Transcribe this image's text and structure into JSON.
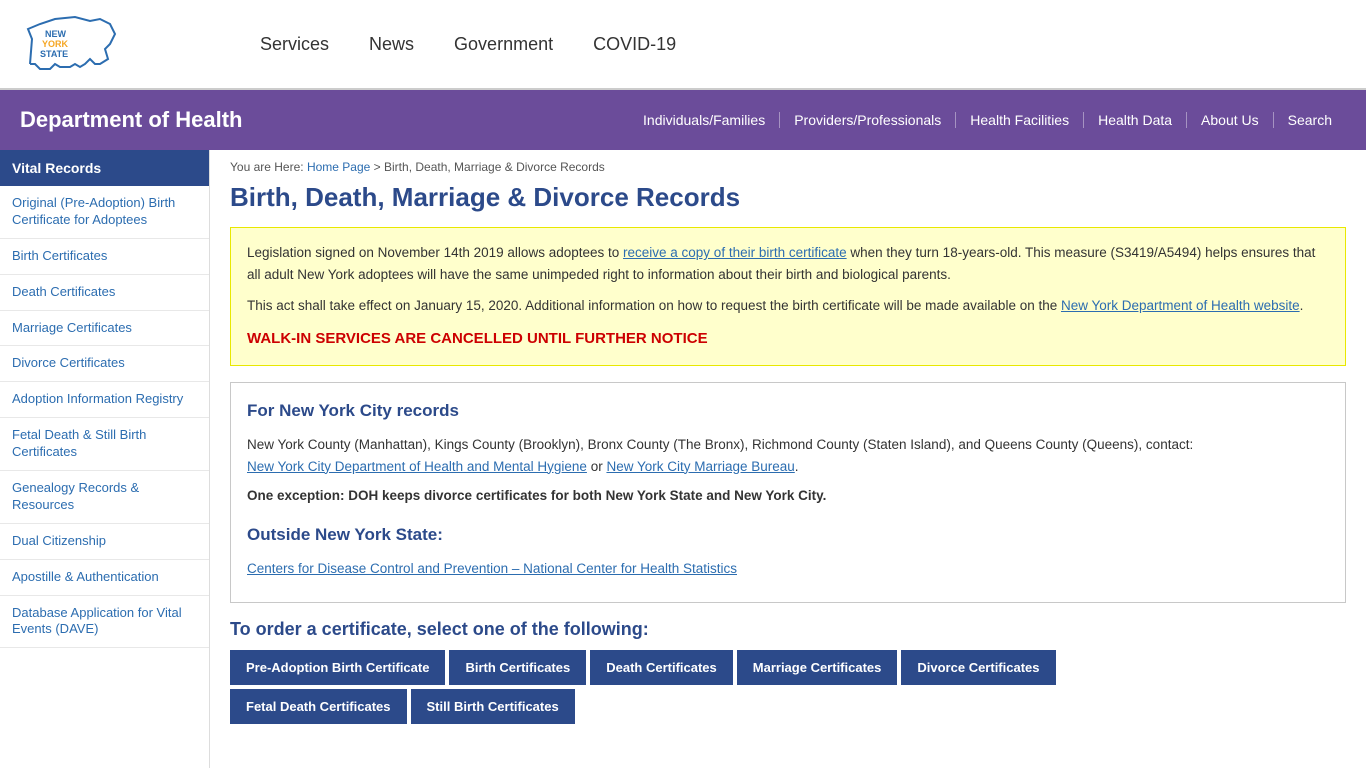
{
  "topnav": {
    "links": [
      {
        "label": "Services",
        "href": "#"
      },
      {
        "label": "News",
        "href": "#"
      },
      {
        "label": "Government",
        "href": "#"
      },
      {
        "label": "COVID-19",
        "href": "#"
      }
    ]
  },
  "purpleHeader": {
    "title": "Department of Health",
    "navLinks": [
      {
        "label": "Individuals/Families",
        "href": "#"
      },
      {
        "label": "Providers/Professionals",
        "href": "#"
      },
      {
        "label": "Health Facilities",
        "href": "#"
      },
      {
        "label": "Health Data",
        "href": "#"
      },
      {
        "label": "About Us",
        "href": "#"
      },
      {
        "label": "Search",
        "href": "#"
      }
    ]
  },
  "sidebar": {
    "title": "Vital Records",
    "links": [
      {
        "label": "Original (Pre-Adoption) Birth Certificate for Adoptees",
        "href": "#"
      },
      {
        "label": "Birth Certificates",
        "href": "#"
      },
      {
        "label": "Death Certificates",
        "href": "#"
      },
      {
        "label": "Marriage Certificates",
        "href": "#"
      },
      {
        "label": "Divorce Certificates",
        "href": "#"
      },
      {
        "label": "Adoption Information Registry",
        "href": "#"
      },
      {
        "label": "Fetal Death & Still Birth Certificates",
        "href": "#"
      },
      {
        "label": "Genealogy Records & Resources",
        "href": "#"
      },
      {
        "label": "Dual Citizenship",
        "href": "#"
      },
      {
        "label": "Apostille & Authentication",
        "href": "#"
      },
      {
        "label": "Database Application for Vital Events (DAVE)",
        "href": "#"
      }
    ]
  },
  "breadcrumb": {
    "prefix": "You are Here:",
    "homeLabel": "Home Page",
    "homeHref": "#",
    "current": "Birth, Death, Marriage & Divorce Records"
  },
  "pageTitle": "Birth, Death, Marriage & Divorce Records",
  "infoBox": {
    "text1": "Legislation signed on November 14th 2019 allows adoptees to ",
    "link1Label": "receive a copy of their birth certificate",
    "link1Href": "#",
    "text2": " when they turn 18-years-old. This measure (S3419/A5494) helps ensures that all adult New York adoptees will have the same unimpeded right to information about their birth and biological parents.",
    "text3": "This act shall take effect on January 15, 2020. Additional information on how to request the birth certificate will be made available on the ",
    "link2Label": "New York Department of Health website",
    "link2Href": "#",
    "text4": ".",
    "walkInNotice": "WALK-IN SERVICES ARE CANCELLED UNTIL FURTHER NOTICE"
  },
  "nycSection": {
    "heading": "For New York City records",
    "text1": "New York County (Manhattan), Kings County (Brooklyn), Bronx County (The Bronx), Richmond County (Staten Island), and Queens County (Queens), contact:",
    "link1Label": "New York City Department of Health and Mental Hygiene",
    "link1Href": "#",
    "orText": " or ",
    "link2Label": "New York City Marriage Bureau",
    "link2Href": "#",
    "boldText": "One exception: DOH keeps divorce certificates for both New York State and New York City."
  },
  "outsideNYSection": {
    "heading": "Outside New York State:",
    "link1Label": "Centers for Disease Control and Prevention – National Center for Health Statistics",
    "link1Href": "#"
  },
  "orderSection": {
    "title": "To order a certificate, select one of the following:",
    "buttons": [
      {
        "label": "Pre-Adoption Birth Certificate"
      },
      {
        "label": "Birth Certificates"
      },
      {
        "label": "Death Certificates"
      },
      {
        "label": "Marriage Certificates"
      },
      {
        "label": "Divorce Certificates"
      }
    ],
    "buttonsRow2": [
      {
        "label": "Fetal Death Certificates"
      },
      {
        "label": "Still Birth Certificates"
      }
    ]
  }
}
